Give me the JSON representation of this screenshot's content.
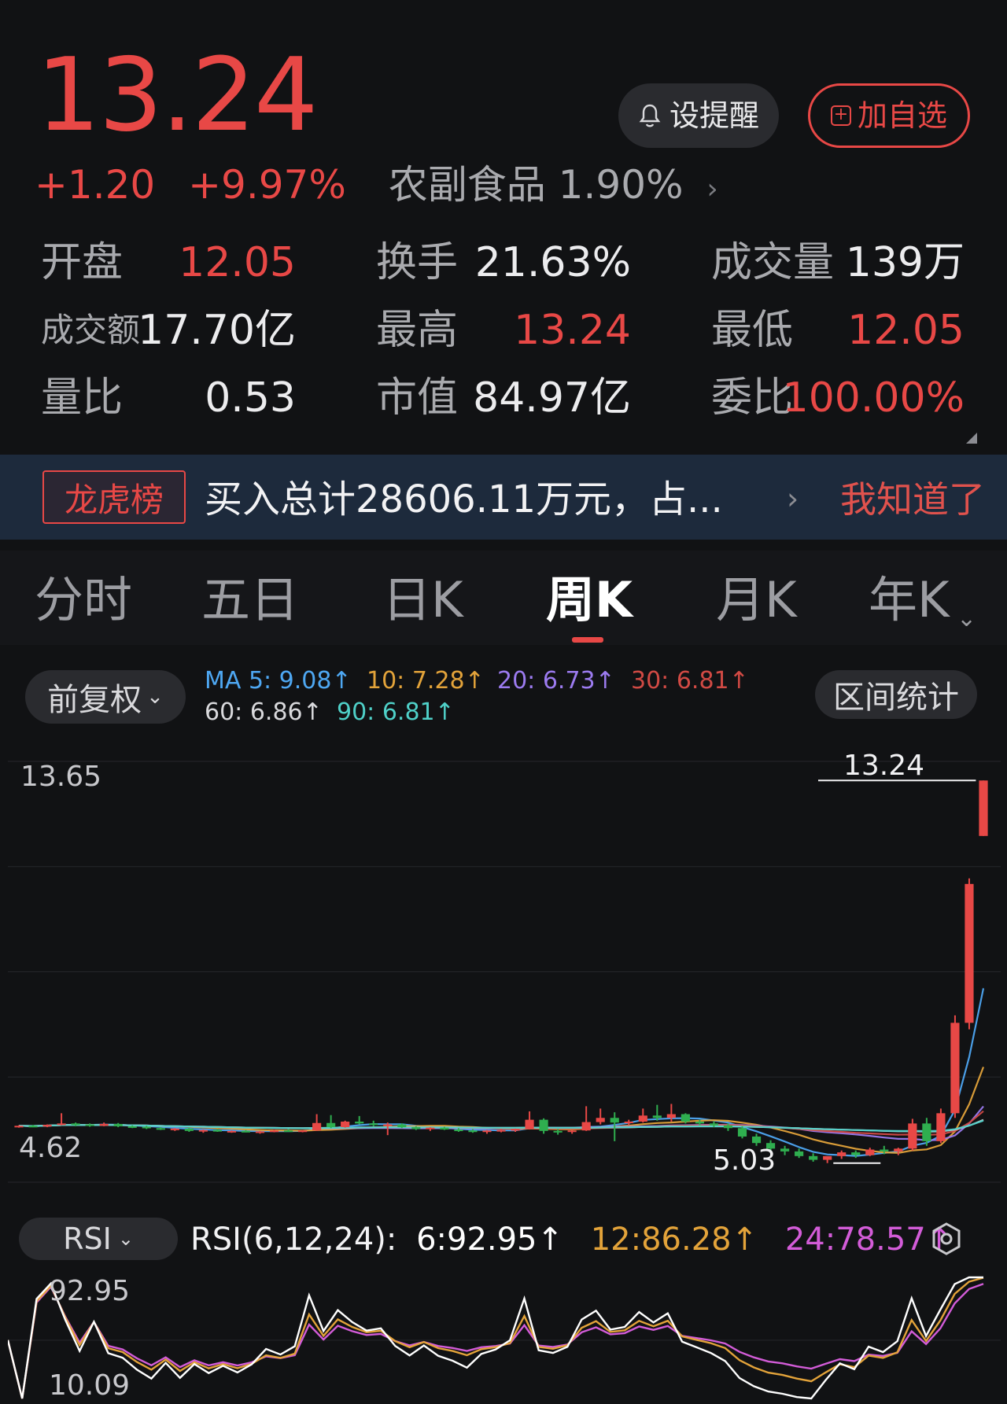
{
  "quote": {
    "price": "13.24",
    "change": "+1.20",
    "change_pct": "+9.97%",
    "sector": "农副食品 1.90%",
    "alert_label": "设提醒",
    "watch_label": "加自选",
    "colors": {
      "up": "#e84846",
      "down": "#2fae4f",
      "bg": "#111214"
    }
  },
  "stats": [
    {
      "label": "开盘",
      "value": "12.05",
      "tone": "red"
    },
    {
      "label": "换手",
      "value": "21.63%",
      "tone": "white"
    },
    {
      "label": "成交量",
      "value": "139万",
      "tone": "white"
    },
    {
      "label": "成交额",
      "value": "17.70亿",
      "tone": "white"
    },
    {
      "label": "最高",
      "value": "13.24",
      "tone": "red"
    },
    {
      "label": "最低",
      "value": "12.05",
      "tone": "red"
    },
    {
      "label": "量比",
      "value": "0.53",
      "tone": "white"
    },
    {
      "label": "市值",
      "value": "84.97亿",
      "tone": "white"
    },
    {
      "label": "委比",
      "value": "100.00%",
      "tone": "red"
    }
  ],
  "banner": {
    "tag": "龙虎榜",
    "text": "买入总计28606.11万元，占...",
    "dismiss": "我知道了"
  },
  "tabs": [
    "分时",
    "五日",
    "日K",
    "周K",
    "月K",
    "年K"
  ],
  "active_tab": "周K",
  "chart_controls": {
    "adjust": "前复权",
    "range_stats": "区间统计",
    "ma_labels": [
      {
        "text": "MA 5: 9.08↑",
        "color": "#4ea7f2"
      },
      {
        "text": "10: 7.28↑",
        "color": "#e3a33a"
      },
      {
        "text": "20: 6.73↑",
        "color": "#9c7bf0"
      },
      {
        "text": "30: 6.81↑",
        "color": "#d14a44"
      },
      {
        "text": "60: 6.86↑",
        "color": "#d9d9dc"
      },
      {
        "text": "90: 6.81↑",
        "color": "#4fd0c8"
      }
    ]
  },
  "chart_data": {
    "type": "candlestick",
    "y_axis_top": "13.65",
    "y_axis_bottom": "4.62",
    "ylim": [
      4.62,
      13.65
    ],
    "marker_high": "13.24",
    "marker_low": "5.03",
    "grid": true,
    "candles": [
      [
        5.8,
        5.84,
        5.79,
        5.83
      ],
      [
        5.83,
        5.85,
        5.8,
        5.82
      ],
      [
        5.82,
        5.86,
        5.8,
        5.85
      ],
      [
        5.85,
        6.1,
        5.84,
        5.88
      ],
      [
        5.88,
        5.9,
        5.82,
        5.86
      ],
      [
        5.86,
        5.88,
        5.81,
        5.83
      ],
      [
        5.83,
        5.9,
        5.82,
        5.87
      ],
      [
        5.87,
        5.89,
        5.8,
        5.82
      ],
      [
        5.82,
        5.84,
        5.78,
        5.81
      ],
      [
        5.81,
        5.83,
        5.76,
        5.78
      ],
      [
        5.78,
        5.8,
        5.74,
        5.75
      ],
      [
        5.75,
        5.78,
        5.72,
        5.77
      ],
      [
        5.77,
        5.79,
        5.7,
        5.72
      ],
      [
        5.72,
        5.75,
        5.68,
        5.74
      ],
      [
        5.74,
        5.76,
        5.7,
        5.71
      ],
      [
        5.71,
        5.73,
        5.68,
        5.72
      ],
      [
        5.72,
        5.74,
        5.69,
        5.7
      ],
      [
        5.7,
        5.72,
        5.66,
        5.71
      ],
      [
        5.71,
        5.75,
        5.69,
        5.73
      ],
      [
        5.73,
        5.76,
        5.7,
        5.72
      ],
      [
        5.72,
        5.74,
        5.69,
        5.73
      ],
      [
        5.73,
        6.08,
        5.72,
        5.89
      ],
      [
        5.89,
        6.06,
        5.78,
        5.8
      ],
      [
        5.8,
        5.94,
        5.79,
        5.92
      ],
      [
        5.92,
        6.04,
        5.86,
        5.88
      ],
      [
        5.88,
        5.94,
        5.82,
        5.85
      ],
      [
        5.85,
        5.9,
        5.63,
        5.86
      ],
      [
        5.86,
        5.88,
        5.78,
        5.8
      ],
      [
        5.8,
        5.82,
        5.74,
        5.76
      ],
      [
        5.76,
        5.8,
        5.72,
        5.79
      ],
      [
        5.79,
        5.81,
        5.74,
        5.75
      ],
      [
        5.75,
        5.78,
        5.7,
        5.73
      ],
      [
        5.73,
        5.76,
        5.68,
        5.7
      ],
      [
        5.7,
        5.74,
        5.66,
        5.73
      ],
      [
        5.73,
        5.76,
        5.69,
        5.74
      ],
      [
        5.74,
        5.77,
        5.7,
        5.76
      ],
      [
        5.76,
        6.14,
        5.75,
        5.96
      ],
      [
        5.96,
        5.99,
        5.66,
        5.72
      ],
      [
        5.72,
        5.76,
        5.64,
        5.7
      ],
      [
        5.7,
        5.74,
        5.66,
        5.73
      ],
      [
        5.73,
        6.25,
        5.72,
        5.91
      ],
      [
        5.91,
        6.2,
        5.86,
        6.0
      ],
      [
        6.0,
        6.12,
        5.5,
        5.9
      ],
      [
        5.9,
        5.96,
        5.84,
        5.92
      ],
      [
        5.92,
        6.2,
        5.9,
        6.05
      ],
      [
        6.05,
        6.28,
        5.94,
        6.0
      ],
      [
        6.0,
        6.3,
        5.92,
        6.08
      ],
      [
        6.08,
        6.1,
        5.88,
        5.92
      ],
      [
        5.92,
        5.96,
        5.84,
        5.88
      ],
      [
        5.88,
        5.92,
        5.8,
        5.84
      ],
      [
        5.84,
        5.88,
        5.72,
        5.78
      ],
      [
        5.78,
        5.82,
        5.56,
        5.6
      ],
      [
        5.6,
        5.66,
        5.4,
        5.46
      ],
      [
        5.46,
        5.52,
        5.3,
        5.34
      ],
      [
        5.34,
        5.4,
        5.2,
        5.28
      ],
      [
        5.28,
        5.34,
        5.14,
        5.18
      ],
      [
        5.18,
        5.24,
        5.06,
        5.1
      ],
      [
        5.1,
        5.16,
        5.03,
        5.18
      ],
      [
        5.18,
        5.3,
        5.12,
        5.26
      ],
      [
        5.26,
        5.3,
        5.14,
        5.2
      ],
      [
        5.2,
        5.36,
        5.18,
        5.32
      ],
      [
        5.32,
        5.4,
        5.22,
        5.28
      ],
      [
        5.28,
        5.36,
        5.2,
        5.34
      ],
      [
        5.34,
        5.98,
        5.3,
        5.88
      ],
      [
        5.88,
        6.0,
        5.4,
        5.5
      ],
      [
        5.5,
        6.2,
        5.46,
        6.1
      ],
      [
        6.1,
        8.2,
        6.0,
        8.04
      ],
      [
        8.04,
        11.14,
        7.9,
        11.02
      ],
      [
        12.05,
        13.24,
        12.05,
        13.24
      ]
    ],
    "series": [
      {
        "name": "MA5",
        "color": "#4ea7f2"
      },
      {
        "name": "MA10",
        "color": "#e3a33a"
      },
      {
        "name": "MA20",
        "color": "#9c7bf0"
      },
      {
        "name": "MA30",
        "color": "#d14a44"
      },
      {
        "name": "MA60",
        "color": "#d9d9dc"
      },
      {
        "name": "MA90",
        "color": "#4fd0c8"
      }
    ]
  },
  "rsi": {
    "selector": "RSI",
    "title": "RSI(6,12,24):",
    "rsi6": "6:92.95↑",
    "rsi12": "12:86.28↑",
    "rsi24": "24:78.57↑",
    "axis_top": "92.95",
    "axis_bottom": "10.09",
    "ylim": [
      10.09,
      92.95
    ],
    "colors": {
      "rsi6": "#ffffff",
      "rsi12": "#e3a33a",
      "rsi24": "#d35cd8"
    }
  }
}
